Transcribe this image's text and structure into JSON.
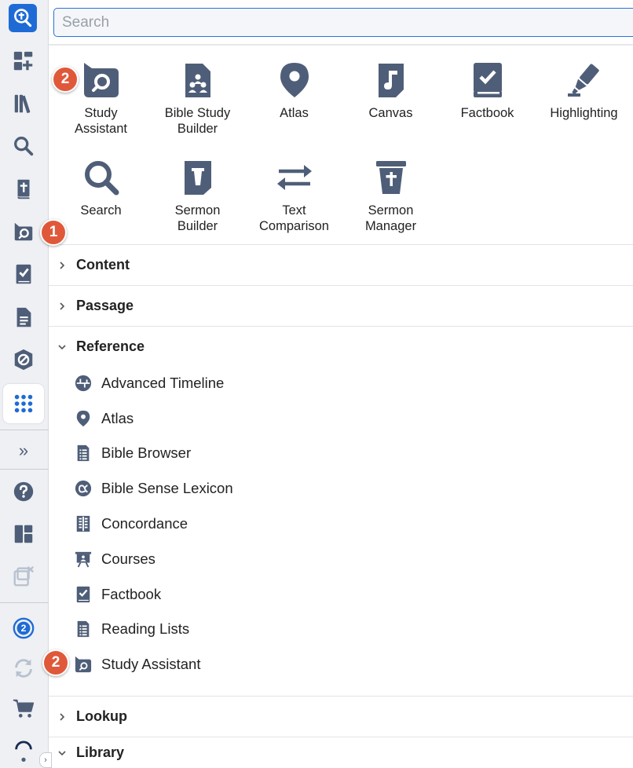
{
  "search": {
    "placeholder": "Search"
  },
  "badges": {
    "one": "1",
    "two": "2"
  },
  "rail": {
    "items": [
      {
        "name": "logo-icon"
      },
      {
        "name": "add-dashboard-icon"
      },
      {
        "name": "library-icon"
      },
      {
        "name": "search-icon"
      },
      {
        "name": "bible-icon"
      },
      {
        "name": "study-assistant-icon"
      },
      {
        "name": "factbook-icon"
      },
      {
        "name": "document-icon"
      },
      {
        "name": "guides-icon"
      },
      {
        "name": "apps-grid-icon"
      },
      {
        "name": "expand-icon",
        "glyph": "»"
      },
      {
        "name": "help-icon"
      },
      {
        "name": "layouts-icon"
      },
      {
        "name": "close-panels-icon"
      },
      {
        "name": "notifications-icon",
        "count": "2"
      },
      {
        "name": "sync-icon"
      },
      {
        "name": "cart-icon"
      },
      {
        "name": "more-icon"
      }
    ]
  },
  "tools": [
    {
      "label": "Study\nAssistant",
      "icon": "study-assistant-icon"
    },
    {
      "label": "Bible Study\nBuilder",
      "icon": "bible-study-builder-icon"
    },
    {
      "label": "Atlas",
      "icon": "atlas-icon"
    },
    {
      "label": "Canvas",
      "icon": "canvas-icon"
    },
    {
      "label": "Factbook",
      "icon": "factbook-icon"
    },
    {
      "label": "Highlighting",
      "icon": "highlighter-icon"
    },
    {
      "label": "Search",
      "icon": "search-icon"
    },
    {
      "label": "Sermon\nBuilder",
      "icon": "sermon-builder-icon"
    },
    {
      "label": "Text\nComparison",
      "icon": "text-comparison-icon"
    },
    {
      "label": "Sermon\nManager",
      "icon": "sermon-manager-icon"
    }
  ],
  "sections": {
    "content": "Content",
    "passage": "Passage",
    "reference": "Reference",
    "lookup": "Lookup",
    "library": "Library"
  },
  "reference_items": [
    {
      "label": "Advanced Timeline",
      "icon": "timeline-icon"
    },
    {
      "label": "Atlas",
      "icon": "map-pin-icon"
    },
    {
      "label": "Bible Browser",
      "icon": "list-document-icon"
    },
    {
      "label": "Bible Sense Lexicon",
      "icon": "lexicon-icon"
    },
    {
      "label": "Concordance",
      "icon": "concordance-icon"
    },
    {
      "label": "Courses",
      "icon": "courses-icon"
    },
    {
      "label": "Factbook",
      "icon": "factbook-icon"
    },
    {
      "label": "Reading Lists",
      "icon": "reading-list-icon"
    },
    {
      "label": "Study Assistant",
      "icon": "study-assistant-icon"
    }
  ],
  "colors": {
    "accent": "#1f6bd6",
    "badge": "#e0583a",
    "icon": "#4f5e78"
  }
}
